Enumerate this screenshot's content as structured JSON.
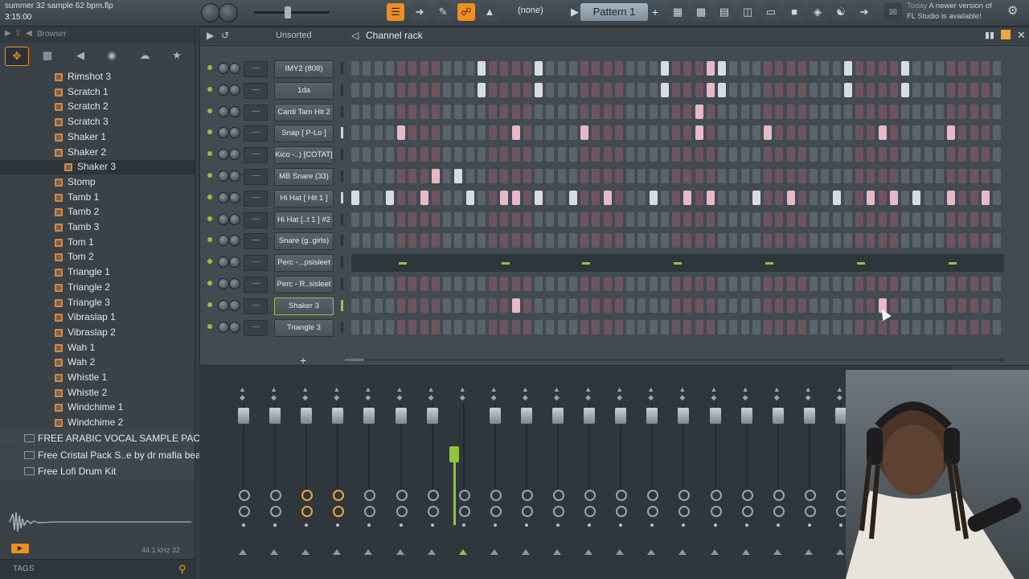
{
  "topbar": {
    "song_title": "summer 32 sample 62 bpm.flp",
    "time": "3:15:00",
    "pattern_none": "(none)",
    "pattern_label": "Pattern 1",
    "pattern_plus": "+",
    "news_today": "Today",
    "news_line1": "A newer version of",
    "news_line2": "FL Studio is available!"
  },
  "browser": {
    "header_label": "Browser",
    "tree_items": [
      {
        "label": "Rimshot 3",
        "selected": false
      },
      {
        "label": "Scratch 1",
        "selected": false
      },
      {
        "label": "Scratch 2",
        "selected": false
      },
      {
        "label": "Scratch 3",
        "selected": false
      },
      {
        "label": "Shaker 1",
        "selected": false
      },
      {
        "label": "Shaker 2",
        "selected": false
      },
      {
        "label": "Shaker 3",
        "selected": true
      },
      {
        "label": "Stomp",
        "selected": false
      },
      {
        "label": "Tamb 1",
        "selected": false
      },
      {
        "label": "Tamb 2",
        "selected": false
      },
      {
        "label": "Tamb 3",
        "selected": false
      },
      {
        "label": "Tom 1",
        "selected": false
      },
      {
        "label": "Tom 2",
        "selected": false
      },
      {
        "label": "Triangle 1",
        "selected": false
      },
      {
        "label": "Triangle 2",
        "selected": false
      },
      {
        "label": "Triangle 3",
        "selected": false
      },
      {
        "label": "Vibraslap 1",
        "selected": false
      },
      {
        "label": "Vibraslap 2",
        "selected": false
      },
      {
        "label": "Wah 1",
        "selected": false
      },
      {
        "label": "Wah 2",
        "selected": false
      },
      {
        "label": "Whistle 1",
        "selected": false
      },
      {
        "label": "Whistle 2",
        "selected": false
      },
      {
        "label": "Windchime 1",
        "selected": false
      },
      {
        "label": "Windchime 2",
        "selected": false
      }
    ],
    "folders": [
      "FREE ARABIC VOCAL SAMPLE PACK",
      "Free Cristal Pack  S..e by dr mafia beats",
      "Free Lofi Drum Kit"
    ],
    "sample_info": "44.1 kHz 32",
    "tags_label": "TAGS"
  },
  "rack": {
    "filter_label": "Unsorted",
    "title": "Channel rack",
    "add_label": "+",
    "channels": [
      {
        "name": "IMY2 (808)",
        "steps": [
          11,
          16,
          27,
          31,
          32,
          43,
          48
        ]
      },
      {
        "name": "1da",
        "steps": [
          11,
          16,
          27,
          31,
          32,
          43,
          48
        ]
      },
      {
        "name": "Cardi Tam Hit 2",
        "steps": [
          30
        ]
      },
      {
        "name": "Snap [ P-Lo ]",
        "steps": [
          4,
          14,
          20,
          30,
          36,
          46,
          52
        ],
        "marked": true
      },
      {
        "name": "Kico -..) [COTAT]",
        "steps": []
      },
      {
        "name": "MB Snare (33)",
        "steps": [
          7,
          9
        ]
      },
      {
        "name": "Hi Hat [ Hit 1 ]",
        "steps": [
          0,
          3,
          6,
          10,
          13,
          14,
          16,
          19,
          22,
          26,
          29,
          31,
          35,
          38,
          42,
          45,
          47,
          49,
          52,
          55
        ],
        "marked": true
      },
      {
        "name": "Hi Hat [..t 1 ] #2",
        "steps": []
      },
      {
        "name": "Snare (g..girls)",
        "steps": []
      },
      {
        "name": "Perc -...psisleet",
        "pianoroll": true,
        "notes": [
          4,
          13,
          20,
          28,
          36,
          44,
          52
        ]
      },
      {
        "name": "Perc - R..sisleet",
        "steps": []
      },
      {
        "name": "Shaker 3",
        "steps": [
          14,
          46
        ],
        "selected": true
      },
      {
        "name": "Triangle 3",
        "steps": []
      }
    ]
  },
  "mixer": {
    "strip_count": 20,
    "master_strip_index": 7,
    "orange_knob_strips": [
      2,
      3
    ]
  },
  "colors": {
    "accent": "#f08f1f",
    "led_green": "#8cc63f",
    "step_on": "#d6dde2",
    "step_on_alt": "#e8b8c4"
  }
}
